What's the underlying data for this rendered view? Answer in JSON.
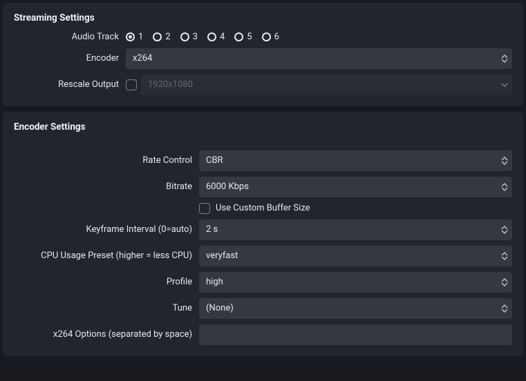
{
  "streaming": {
    "title": "Streaming Settings",
    "audio_track_label": "Audio Track",
    "audio_track_options": {
      "o1": "1",
      "o2": "2",
      "o3": "3",
      "o4": "4",
      "o5": "5",
      "o6": "6"
    },
    "audio_track_selected": "1",
    "encoder_label": "Encoder",
    "encoder_value": "x264",
    "rescale_label": "Rescale Output",
    "rescale_checked": false,
    "rescale_placeholder": "1920x1080"
  },
  "encoder": {
    "title": "Encoder Settings",
    "rate_control_label": "Rate Control",
    "rate_control_value": "CBR",
    "bitrate_label": "Bitrate",
    "bitrate_value": "6000 Kbps",
    "custom_buffer_checked": false,
    "custom_buffer_label": "Use Custom Buffer Size",
    "keyframe_label": "Keyframe Interval (0=auto)",
    "keyframe_value": "2 s",
    "cpu_preset_label": "CPU Usage Preset (higher = less CPU)",
    "cpu_preset_value": "veryfast",
    "profile_label": "Profile",
    "profile_value": "high",
    "tune_label": "Tune",
    "tune_value": "(None)",
    "x264_opts_label": "x264 Options (separated by space)",
    "x264_opts_value": ""
  }
}
